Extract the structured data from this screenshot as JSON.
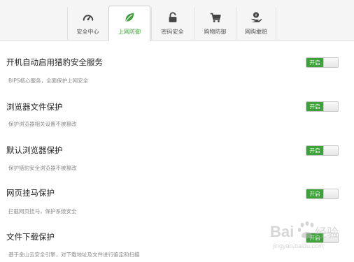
{
  "tabs": [
    {
      "label": "安全中心",
      "icon": "speedometer-icon",
      "active": false
    },
    {
      "label": "上网防御",
      "icon": "leaf-icon",
      "active": true
    },
    {
      "label": "密码安全",
      "icon": "lock-icon",
      "active": false
    },
    {
      "label": "购物防御",
      "icon": "shopping-cart-icon",
      "active": false
    },
    {
      "label": "网购敢赔",
      "icon": "hand-coin-icon",
      "active": false
    }
  ],
  "settings": [
    {
      "title": "开机自动启用猎豹安全服务",
      "desc": "BIPS核心服务，全面保护上网安全",
      "toggle": "开启"
    },
    {
      "title": "浏览器文件保护",
      "desc": "保护浏览器相关设置不被篡改",
      "toggle": "开启"
    },
    {
      "title": "默认浏览器保护",
      "desc": "保护猎豹安全浏览器不被篡改",
      "toggle": "开启"
    },
    {
      "title": "网页挂马保护",
      "desc": "拦截网页挂马，保护系统安全",
      "toggle": "开启"
    },
    {
      "title": "文件下载保护",
      "desc": "基于金山云安全引擎，对下载地址及文件进行鉴定和扫描",
      "toggle": "开启"
    }
  ],
  "colors": {
    "accent": "#3ea23a"
  },
  "watermark": "Baidu 经验 jingyan.baidu.com"
}
